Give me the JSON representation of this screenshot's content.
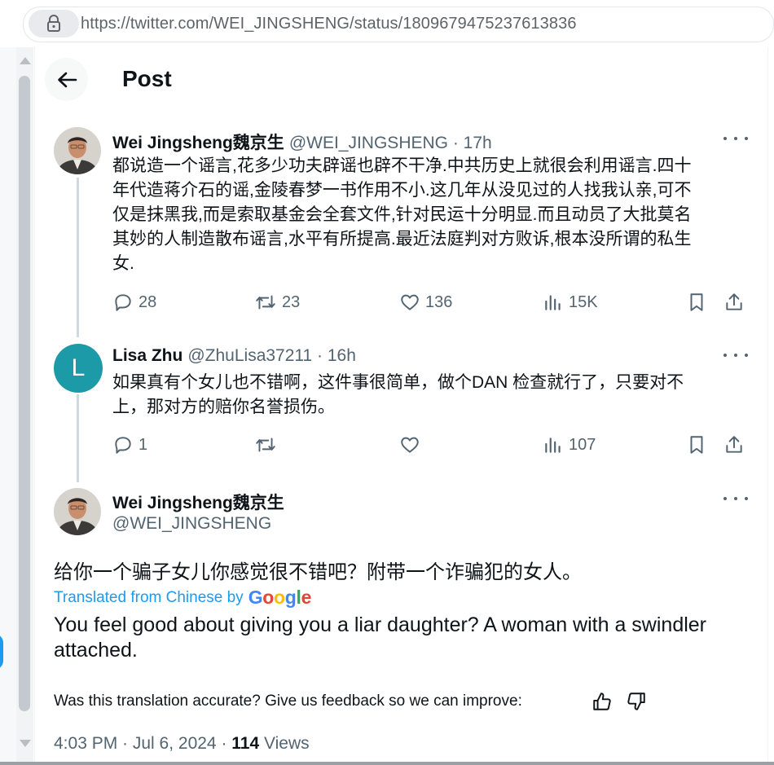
{
  "browser": {
    "url": "https://twitter.com/WEI_JINGSHENG/status/1809679475237613836"
  },
  "header": {
    "title": "Post"
  },
  "tweet1": {
    "name": "Wei Jingsheng魏京生",
    "handle_time": "@WEI_JINGSHENG · 17h",
    "lines": [
      "都说造一个谣言,花多少功夫辟谣也辟不干净.中共历史上就很会利用谣言.四十",
      "年代造蒋介石的谣,金陵春梦一书作用不小.这几年从没见过的人找我认亲,可不",
      "仅是抹黑我,而是索取基金会全套文件,针对民运十分明显.而且动员了大批莫名",
      "其妙的人制造散布谣言,水平有所提高.最近法庭判对方败诉,根本没所谓的私生",
      "女."
    ],
    "replies": "28",
    "reposts": "23",
    "likes": "136",
    "views": "15K"
  },
  "tweet2": {
    "avatar_letter": "L",
    "avatar_color": "#1d9aa8",
    "name": "Lisa Zhu",
    "handle_time": "@ZhuLisa37211 · 16h",
    "lines": [
      "如果真有个女儿也不错啊，这件事很简单，做个DAN 检查就行了，只要对不",
      "上，那对方的赔你名誉损伤。"
    ],
    "replies": "1",
    "views": "107"
  },
  "main_tweet": {
    "name": "Wei Jingsheng魏京生",
    "handle": "@WEI_JINGSHENG",
    "text": "给你一个骗子女儿你感觉很不错吧？附带一个诈骗犯的女人。",
    "translated_label": "Translated from Chinese by",
    "translated_brand": "Google",
    "translation": "You feel good about giving you a liar daughter? A woman with a swindler attached.",
    "feedback": "Was this translation accurate? Give us feedback so we can improve:",
    "time_date": "4:03 PM · Jul 6, 2024 · ",
    "views_count": "114",
    "views_label": " Views"
  },
  "colors": {
    "accent": "#1d9bf0",
    "muted": "#536471",
    "text": "#0f1419"
  }
}
